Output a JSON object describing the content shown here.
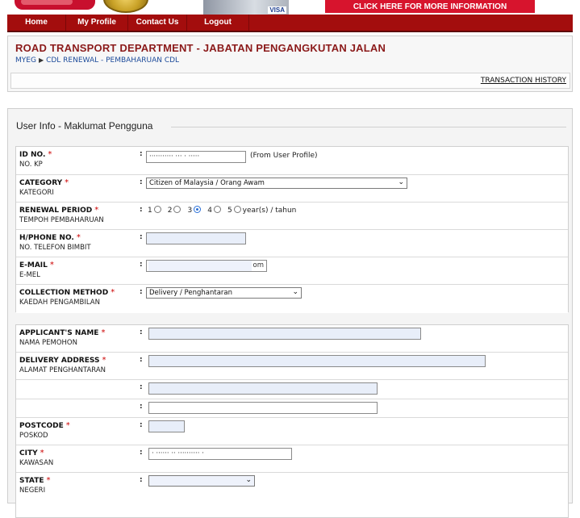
{
  "banner": {
    "info_button": "CLICK HERE FOR MORE INFORMATION",
    "card_brand": "VISA"
  },
  "nav": {
    "items": [
      "Home",
      "My Profile",
      "Contact Us",
      "Logout"
    ]
  },
  "header": {
    "title": "ROAD TRANSPORT DEPARTMENT - JABATAN PENGANGKUTAN JALAN",
    "breadcrumb": [
      "MYEG",
      "CDL RENEWAL - PEMBAHARUAN CDL"
    ],
    "transaction_history": "TRANSACTION HISTORY"
  },
  "form": {
    "legend": "User Info - Maklumat Pengguna",
    "colon": ":",
    "required_mark": "*",
    "id_no": {
      "label": "ID NO.",
      "label_ms": "NO. KP",
      "value": "··········· ··· · ·····",
      "note": "(From User Profile)"
    },
    "category": {
      "label": "CATEGORY",
      "label_ms": "KATEGORI",
      "selected": "Citizen of Malaysia / Orang Awam"
    },
    "renewal_period": {
      "label": "RENEWAL PERIOD",
      "label_ms": "TEMPOH PEMBAHARUAN",
      "options": [
        "1",
        "2",
        "3",
        "4",
        "5"
      ],
      "selected": "3",
      "unit": "year(s) / tahun"
    },
    "phone": {
      "label": "H/PHONE NO.",
      "label_ms": "NO. TELEFON BIMBIT"
    },
    "email": {
      "label": "E-MAIL",
      "label_ms": "E-MEL",
      "value_suffix": "om"
    },
    "collection": {
      "label": "COLLECTION METHOD",
      "label_ms": "KAEDAH PENGAMBILAN",
      "selected": "Delivery / Penghantaran"
    },
    "applicant_name": {
      "label": "APPLICANT'S NAME",
      "label_ms": "NAMA PEMOHON"
    },
    "delivery_address": {
      "label": "DELIVERY ADDRESS",
      "label_ms": "ALAMAT PENGHANTARAN"
    },
    "postcode": {
      "label": "POSTCODE",
      "label_ms": "POSKOD"
    },
    "city": {
      "label": "CITY",
      "label_ms": "KAWASAN",
      "value": "·  ······  ··  ·········· ·"
    },
    "state": {
      "label": "STATE",
      "label_ms": "NEGERI"
    }
  }
}
